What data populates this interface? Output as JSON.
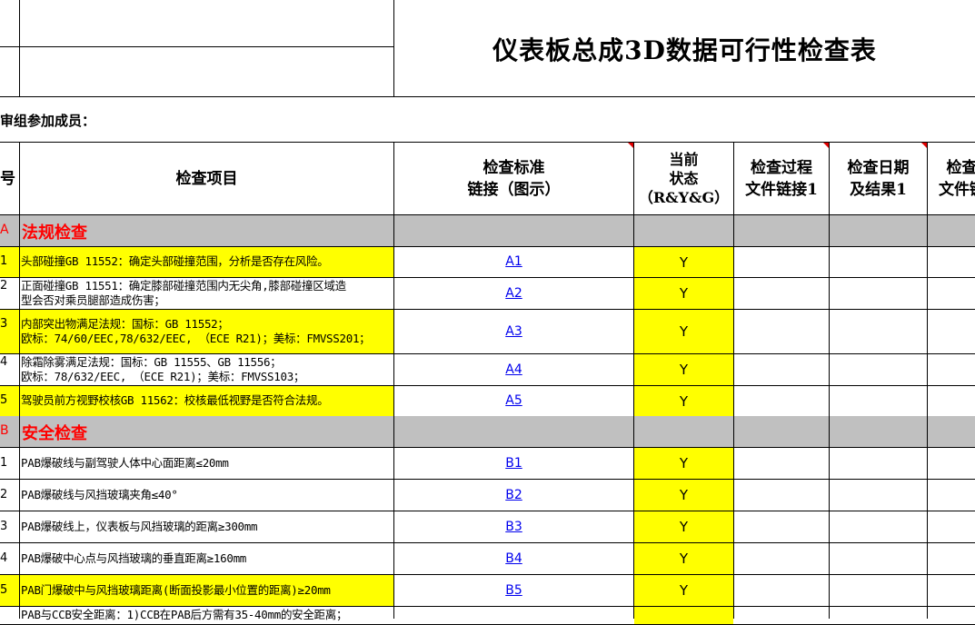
{
  "title": "仪表板总成3D数据可行性检查表",
  "members_label": "审组参加成员：",
  "headers": {
    "no": "号",
    "item": "检查项目",
    "standard": [
      "检查标准",
      "链接（图示）"
    ],
    "status": [
      "当前",
      "状态",
      "（R&Y&G）"
    ],
    "process_file": [
      "检查过程",
      "文件链接1"
    ],
    "date_result": [
      "检查日期",
      "及结果1"
    ],
    "partial": [
      "检查",
      "文件链"
    ]
  },
  "colors": {
    "highlight": "#ffff00",
    "section_bg": "#c0c0c0",
    "section_text": "#ff0000",
    "link": "#0000ee",
    "comment_marker": "#e00000"
  },
  "sections": [
    {
      "letter": "A",
      "title": "法规检查",
      "rows": [
        {
          "no": "1",
          "lines": [
            "头部碰撞GB 11552：确定头部碰撞范围，分析是否存在风险。"
          ],
          "link": "A1",
          "status": "Y"
        },
        {
          "no": "2",
          "lines": [
            "正面碰撞GB 11551：确定膝部碰撞范围内无尖角,膝部碰撞区域造",
            "型会否对乘员腿部造成伤害；"
          ],
          "link": "A2",
          "status": "Y"
        },
        {
          "no": "3",
          "lines": [
            "内部突出物满足法规：国标：GB 11552；",
            "欧标：74/60/EEC,78/632/EEC, （ECE R21)；美标：FMVSS201；"
          ],
          "link": "A3",
          "status": "Y"
        },
        {
          "no": "4",
          "lines": [
            "除霜除雾满足法规：国标：GB 11555、GB 11556；",
            "欧标：78/632/EEC, （ECE R21)；美标：FMVSS103；"
          ],
          "link": "A4",
          "status": "Y"
        },
        {
          "no": "5",
          "lines": [
            "驾驶员前方视野校核GB 11562：校核最低视野是否符合法规。"
          ],
          "link": "A5",
          "status": "Y"
        }
      ]
    },
    {
      "letter": "B",
      "title": "安全检查",
      "rows": [
        {
          "no": "1",
          "lines": [
            "PAB爆破线与副驾驶人体中心面距离≤20mm"
          ],
          "link": "B1",
          "status": "Y"
        },
        {
          "no": "2",
          "lines": [
            "PAB爆破线与风挡玻璃夹角≤40°"
          ],
          "link": "B2",
          "status": "Y"
        },
        {
          "no": "3",
          "lines": [
            "PAB爆破线上，仪表板与风挡玻璃的距离≥300mm"
          ],
          "link": "B3",
          "status": "Y"
        },
        {
          "no": "4",
          "lines": [
            "PAB爆破中心点与风挡玻璃的垂直距离≥160mm"
          ],
          "link": "B4",
          "status": "Y"
        },
        {
          "no": "5",
          "lines": [
            "PAB门爆破中与风挡玻璃距离(断面投影最小位置的距离)≥20mm"
          ],
          "link": "B5",
          "status": "Y"
        },
        {
          "no": "",
          "lines": [
            "PAB与CCB安全距离：1)CCB在PAB后方需有35-40mm的安全距离；"
          ],
          "link": "",
          "status": ""
        }
      ]
    }
  ]
}
